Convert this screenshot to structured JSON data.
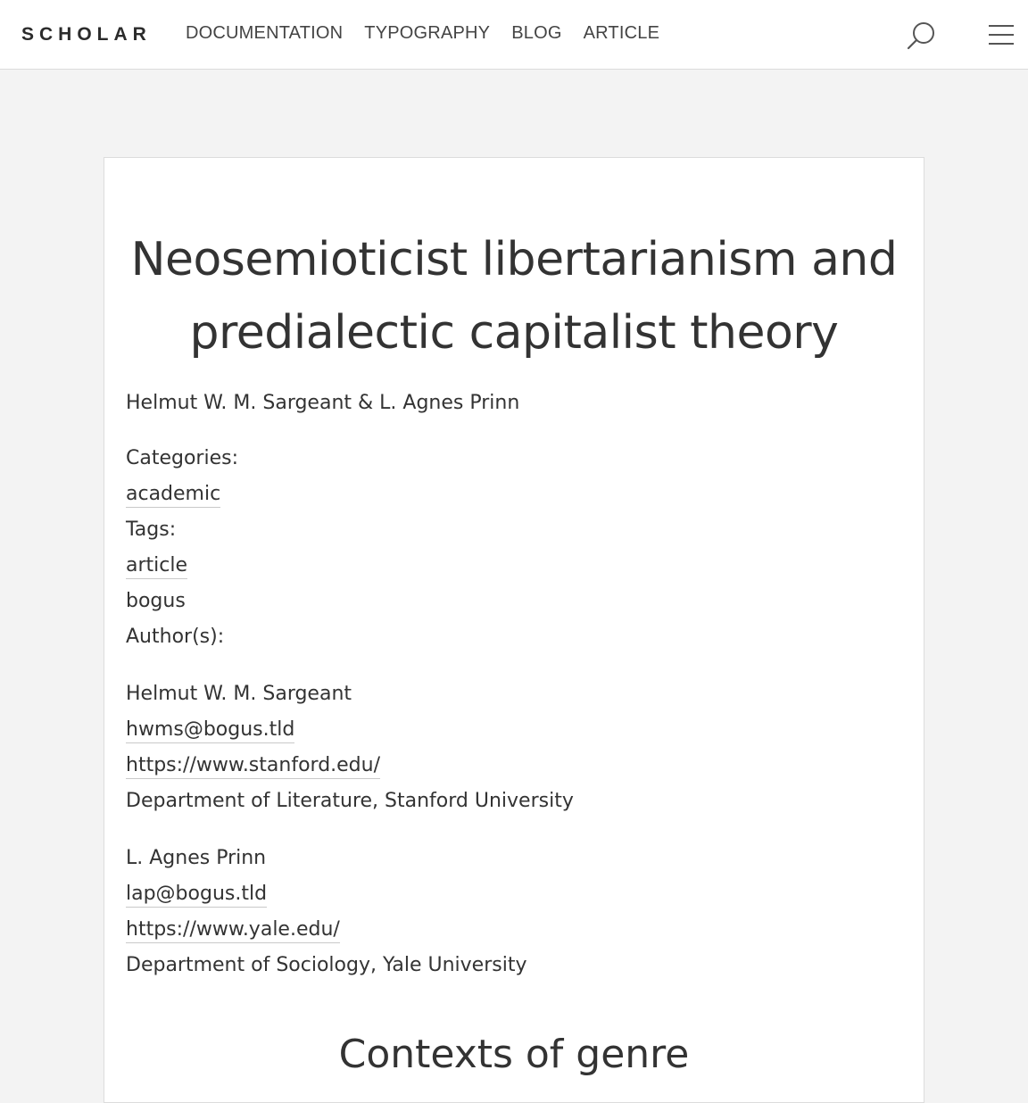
{
  "header": {
    "brand": "SCHOLAR",
    "nav": [
      "DOCUMENTATION",
      "TYPOGRAPHY",
      "BLOG",
      "ARTICLE"
    ]
  },
  "article": {
    "title_line1": "Neosemioticist libertarianism and",
    "title_line2": "predialectic capitalist theory",
    "byline": "Helmut W. M. Sargeant & L. Agnes Prinn",
    "categories_label": "Categories:",
    "categories": [
      "academic"
    ],
    "tags_label": "Tags:",
    "tags": [
      "article",
      "bogus"
    ],
    "authors_label": "Author(s):",
    "authors": [
      {
        "name": "Helmut W. M. Sargeant",
        "email": "hwms@bogus.tld",
        "url": "https://www.stanford.edu/",
        "affiliation": "Department of Literature, Stanford University"
      },
      {
        "name": "L. Agnes Prinn",
        "email": "lap@bogus.tld",
        "url": "https://www.yale.edu/",
        "affiliation": "Department of Sociology, Yale University"
      }
    ],
    "section_heading": "Contexts of genre"
  },
  "colors": {
    "page_background": "#f3f3f3",
    "card_background": "#ffffff",
    "text": "#333333",
    "border": "#dcdcdc"
  },
  "icons": {
    "search": "search-icon",
    "menu": "hamburger-menu-icon"
  }
}
